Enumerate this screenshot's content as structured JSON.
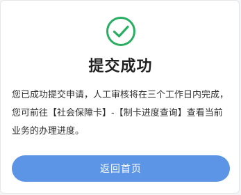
{
  "success_dialog": {
    "icon": "check-circle-icon",
    "title": "提交成功",
    "message": "您已成功提交申请，人工审核将在三个工作日内完成，您可前往【社会保障卡】-【制卡进度查询】查看当前业务的办理进度。",
    "back_button_label": "返回首页"
  },
  "colors": {
    "success_green": "#27ae60",
    "button_blue": "#5c95e6"
  }
}
